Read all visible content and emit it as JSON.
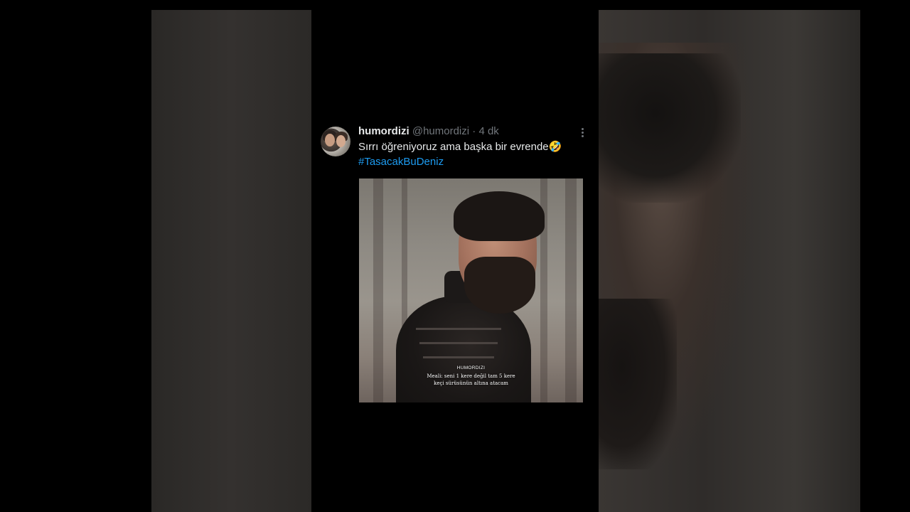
{
  "tweet": {
    "display_name": "humordizi",
    "handle": "@humordizi",
    "separator": "·",
    "time": "4 dk",
    "text": "Sırrı öğreniyoruz ama başka bir evrende",
    "emoji": "🤣",
    "hashtag": "#TasacakBuDeniz",
    "media_caption": {
      "brand": "HUMORDIZI",
      "line1": "Meali: seni 1 kere değil tam 5 kere",
      "line2": "keçi sürüsünün altına atacam"
    }
  },
  "colors": {
    "background": "#000000",
    "text": "#e7e9ea",
    "secondary": "#71767b",
    "link": "#1d9bf0"
  },
  "icons": [
    "more-options-icon"
  ]
}
